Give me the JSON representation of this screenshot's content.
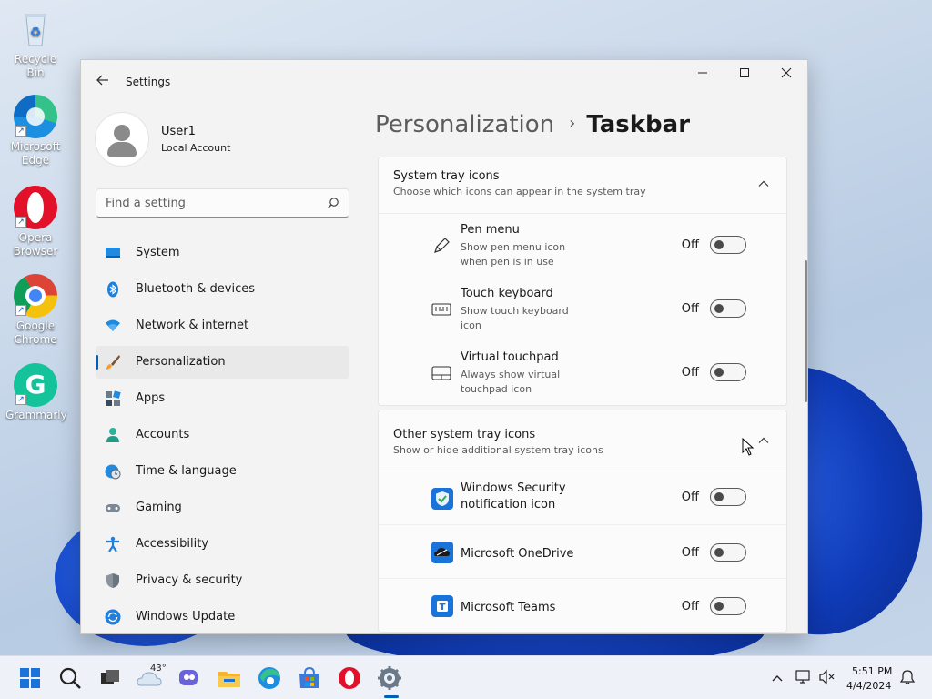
{
  "desktop": {
    "icons": [
      {
        "label": "Recycle Bin",
        "icon": "recycle-bin-icon"
      },
      {
        "label": "Microsoft Edge",
        "icon": "edge-icon"
      },
      {
        "label": "Opera Browser",
        "icon": "opera-icon"
      },
      {
        "label": "Google Chrome",
        "icon": "chrome-icon"
      },
      {
        "label": "Grammarly",
        "icon": "grammarly-icon"
      }
    ]
  },
  "window": {
    "title": "Settings",
    "controls": {
      "minimize": "—",
      "maximize": "☐",
      "close": "✕"
    }
  },
  "profile": {
    "name": "User1",
    "account_type": "Local Account"
  },
  "search": {
    "placeholder": "Find a setting"
  },
  "nav": {
    "items": [
      {
        "label": "System",
        "icon": "system-icon"
      },
      {
        "label": "Bluetooth & devices",
        "icon": "bluetooth-icon"
      },
      {
        "label": "Network & internet",
        "icon": "wifi-icon"
      },
      {
        "label": "Personalization",
        "icon": "brush-icon",
        "active": true
      },
      {
        "label": "Apps",
        "icon": "apps-icon"
      },
      {
        "label": "Accounts",
        "icon": "accounts-icon"
      },
      {
        "label": "Time & language",
        "icon": "clock-globe-icon"
      },
      {
        "label": "Gaming",
        "icon": "gamepad-icon"
      },
      {
        "label": "Accessibility",
        "icon": "accessibility-icon"
      },
      {
        "label": "Privacy & security",
        "icon": "shield-icon"
      },
      {
        "label": "Windows Update",
        "icon": "update-icon"
      }
    ]
  },
  "breadcrumb": {
    "parent": "Personalization",
    "separator": "›",
    "current": "Taskbar"
  },
  "system_tray": {
    "title": "System tray icons",
    "subtitle": "Choose which icons can appear in the system tray",
    "rows": [
      {
        "title": "Pen menu",
        "subtitle": "Show pen menu icon when pen is in use",
        "state": "Off",
        "icon": "pen-icon"
      },
      {
        "title": "Touch keyboard",
        "subtitle": "Show touch keyboard icon",
        "state": "Off",
        "icon": "keyboard-icon"
      },
      {
        "title": "Virtual touchpad",
        "subtitle": "Always show virtual touchpad icon",
        "state": "Off",
        "icon": "touchpad-icon"
      }
    ]
  },
  "other_tray": {
    "title": "Other system tray icons",
    "subtitle": "Show or hide additional system tray icons",
    "rows": [
      {
        "title": "Windows Security notification icon",
        "state": "Off",
        "icon": "windows-security-icon"
      },
      {
        "title": "Microsoft OneDrive",
        "state": "Off",
        "icon": "onedrive-icon"
      },
      {
        "title": "Microsoft Teams",
        "state": "Off",
        "icon": "teams-icon"
      }
    ]
  },
  "taskbar": {
    "weather_temp": "43°",
    "clock_time": "5:51 PM",
    "clock_date": "4/4/2024"
  },
  "colors": {
    "accent": "#005fb8",
    "window_bg": "#f3f3f3"
  }
}
